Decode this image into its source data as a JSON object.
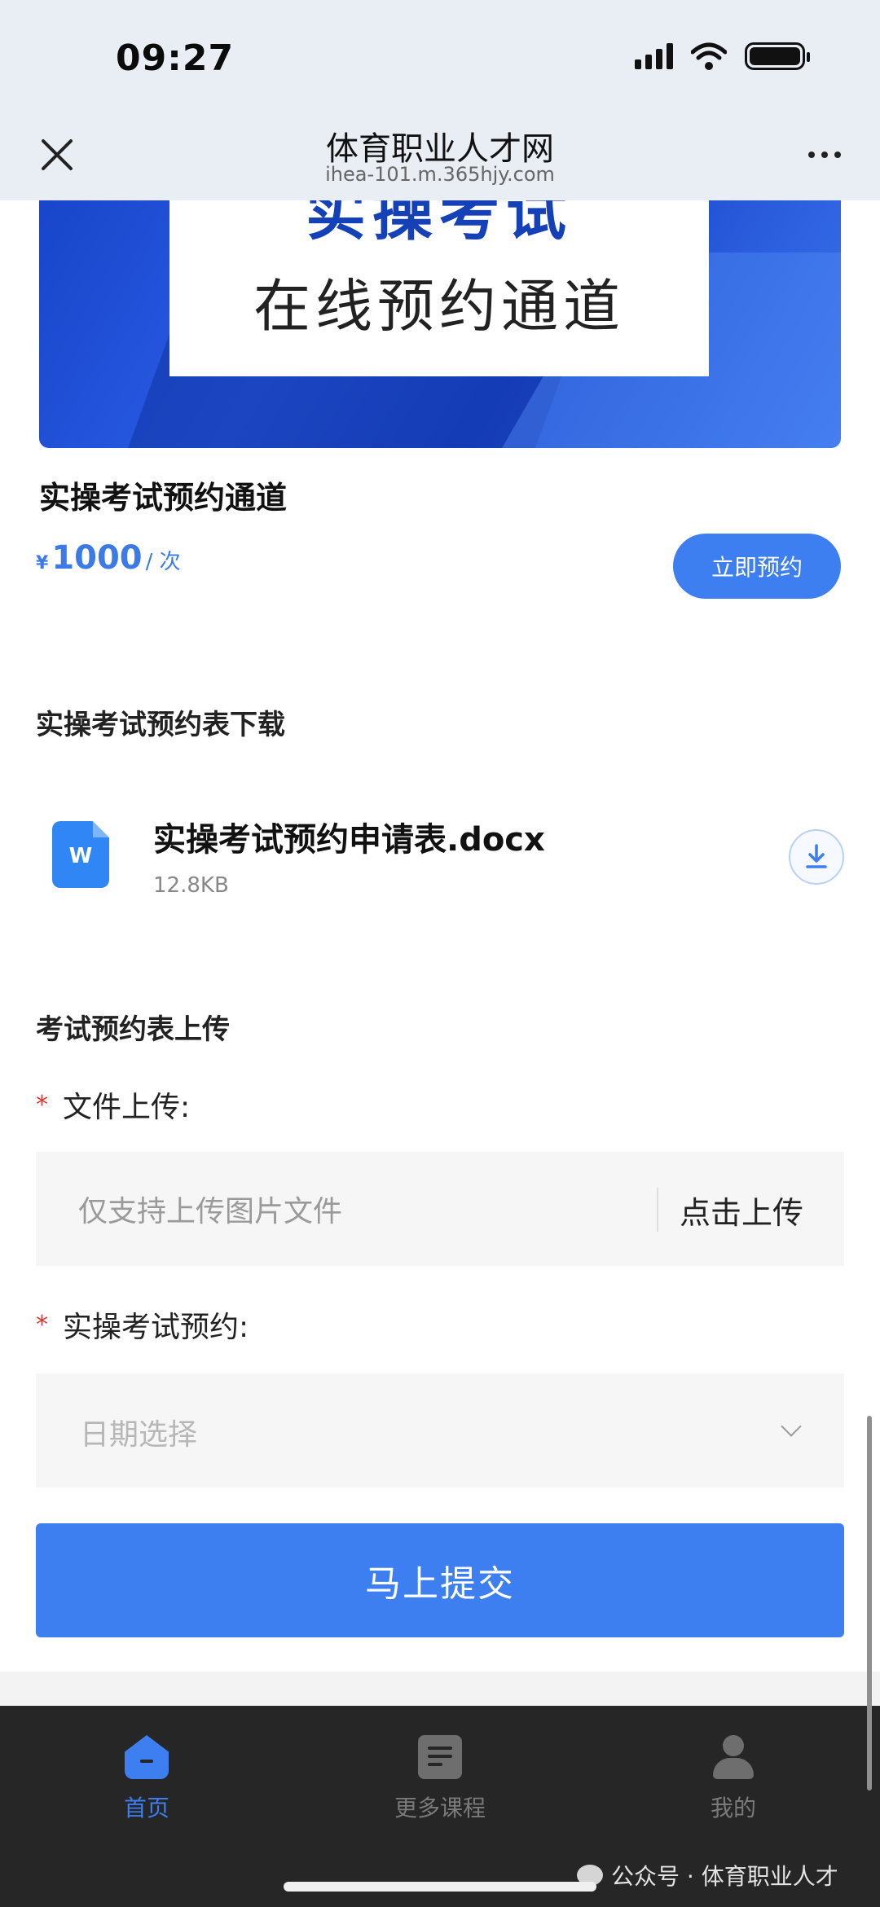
{
  "status_bar": {
    "time": "09:27"
  },
  "header": {
    "title": "体育职业人才网",
    "url": "ihea-101.m.365hjy.com"
  },
  "banner": {
    "big_text": "实操考试",
    "sub_text": "在线预约通道"
  },
  "product": {
    "title": "实操考试预约通道",
    "currency": "¥",
    "price": "1000",
    "unit": "/ 次",
    "book_label": "立即预约"
  },
  "download_section": {
    "title": "实操考试预约表下载",
    "file_name": "实操考试预约申请表.docx",
    "file_size": "12.8KB",
    "file_icon_letter": "W"
  },
  "upload_section": {
    "title": "考试预约表上传",
    "required_mark": "*",
    "file_label": "文件上传:",
    "file_placeholder": "仅支持上传图片文件",
    "upload_action": "点击上传",
    "date_label": "实操考试预约:",
    "date_placeholder": "日期选择",
    "submit_label": "马上提交"
  },
  "tabbar": {
    "items": [
      {
        "label": "首页",
        "icon": "home-icon",
        "active": true
      },
      {
        "label": "更多课程",
        "icon": "book-icon",
        "active": false
      },
      {
        "label": "我的",
        "icon": "user-icon",
        "active": false
      }
    ]
  },
  "watermark": {
    "text": "公众号 · 体育职业人才"
  },
  "colors": {
    "accent": "#3d7ef0",
    "required": "#e0332c",
    "tabbar_bg": "#262626"
  }
}
